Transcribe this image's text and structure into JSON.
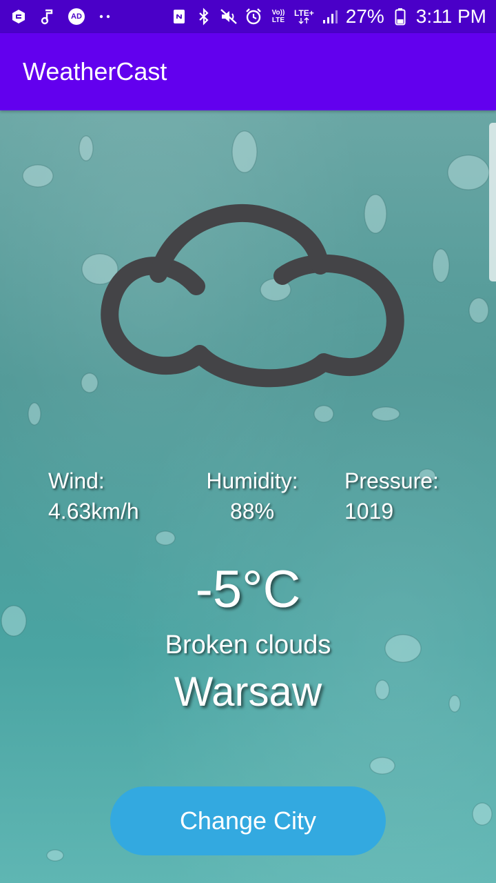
{
  "status_bar": {
    "battery_percent": "27%",
    "time": "3:11 PM",
    "network_volte": "Vo)) LTE",
    "network_lte": "LTE+",
    "ad_badge": "AD",
    "left_icons": [
      "app-icon",
      "music-note-icon",
      "ad-blocker-icon",
      "more-dots-icon"
    ],
    "right_icons": [
      "nfc-icon",
      "bluetooth-icon",
      "mute-icon",
      "alarm-icon",
      "volte-icon",
      "lte-icon",
      "signal-icon",
      "battery-icon"
    ]
  },
  "app_bar": {
    "title": "WeatherCast",
    "color": "#6200ee"
  },
  "weather": {
    "icon": "cloud-icon",
    "wind_label": "Wind:",
    "wind_value": "4.63km/h",
    "humidity_label": "Humidity:",
    "humidity_value": "88%",
    "pressure_label": "Pressure:",
    "pressure_value": "1019",
    "temperature": "-5°C",
    "condition": "Broken clouds",
    "city": "Warsaw"
  },
  "actions": {
    "change_city_label": "Change City",
    "button_color": "#33a9e0"
  }
}
